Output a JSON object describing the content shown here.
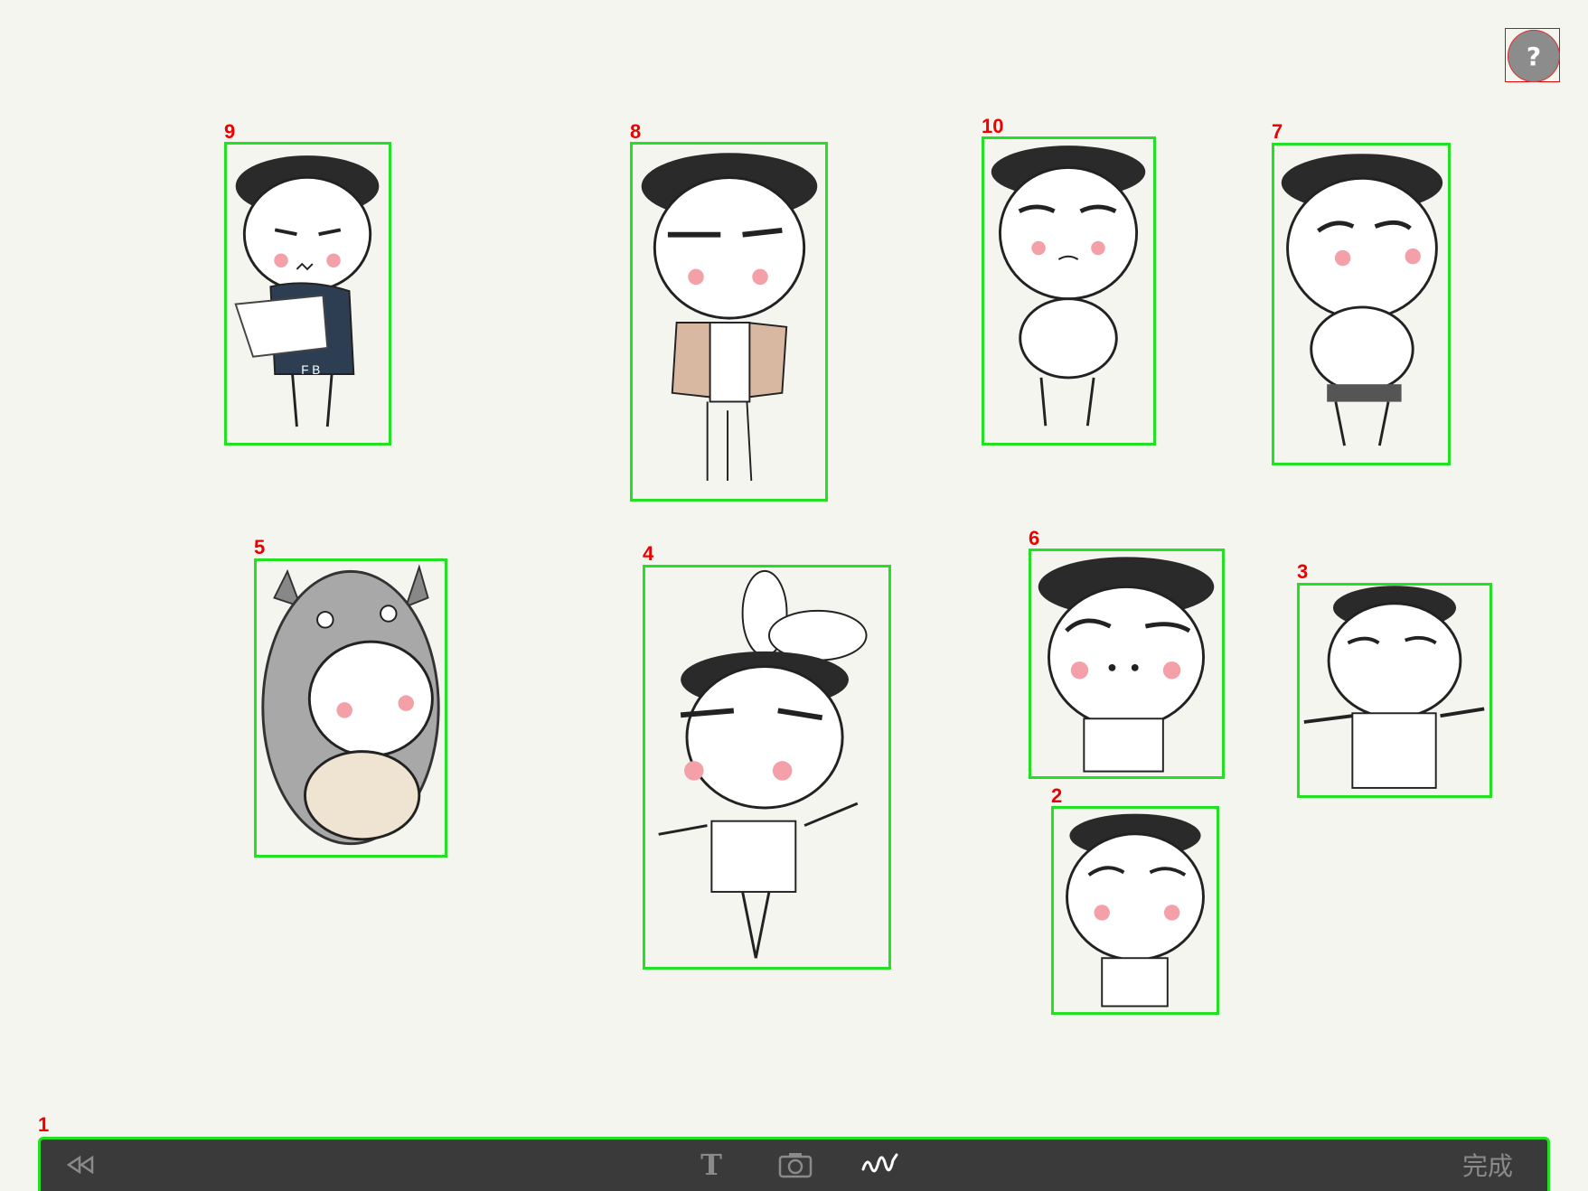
{
  "help_button": {
    "label": "?"
  },
  "stickers": [
    {
      "tag": "9",
      "name": "sticker-laptop-boy"
    },
    {
      "tag": "8",
      "name": "sticker-cardigan-boy"
    },
    {
      "tag": "10",
      "name": "sticker-worried-boy"
    },
    {
      "tag": "7",
      "name": "sticker-thinking-boy"
    },
    {
      "tag": "5",
      "name": "sticker-totoro-costume"
    },
    {
      "tag": "4",
      "name": "sticker-bunny-ballerina"
    },
    {
      "tag": "6",
      "name": "sticker-shy-boy"
    },
    {
      "tag": "3",
      "name": "sticker-shirtless-boy"
    },
    {
      "tag": "2",
      "name": "sticker-small-boy"
    }
  ],
  "toolbar": {
    "tag": "1",
    "back_icon": "rewind-icon",
    "text_label": "T",
    "camera_icon": "camera-icon",
    "draw_icon": "scribble-icon",
    "done_label": "完成"
  },
  "colors": {
    "background": "#f5f5f0",
    "toolbar": "#3a3a3a",
    "highlight": "#22e022",
    "tag": "#ee0000"
  }
}
